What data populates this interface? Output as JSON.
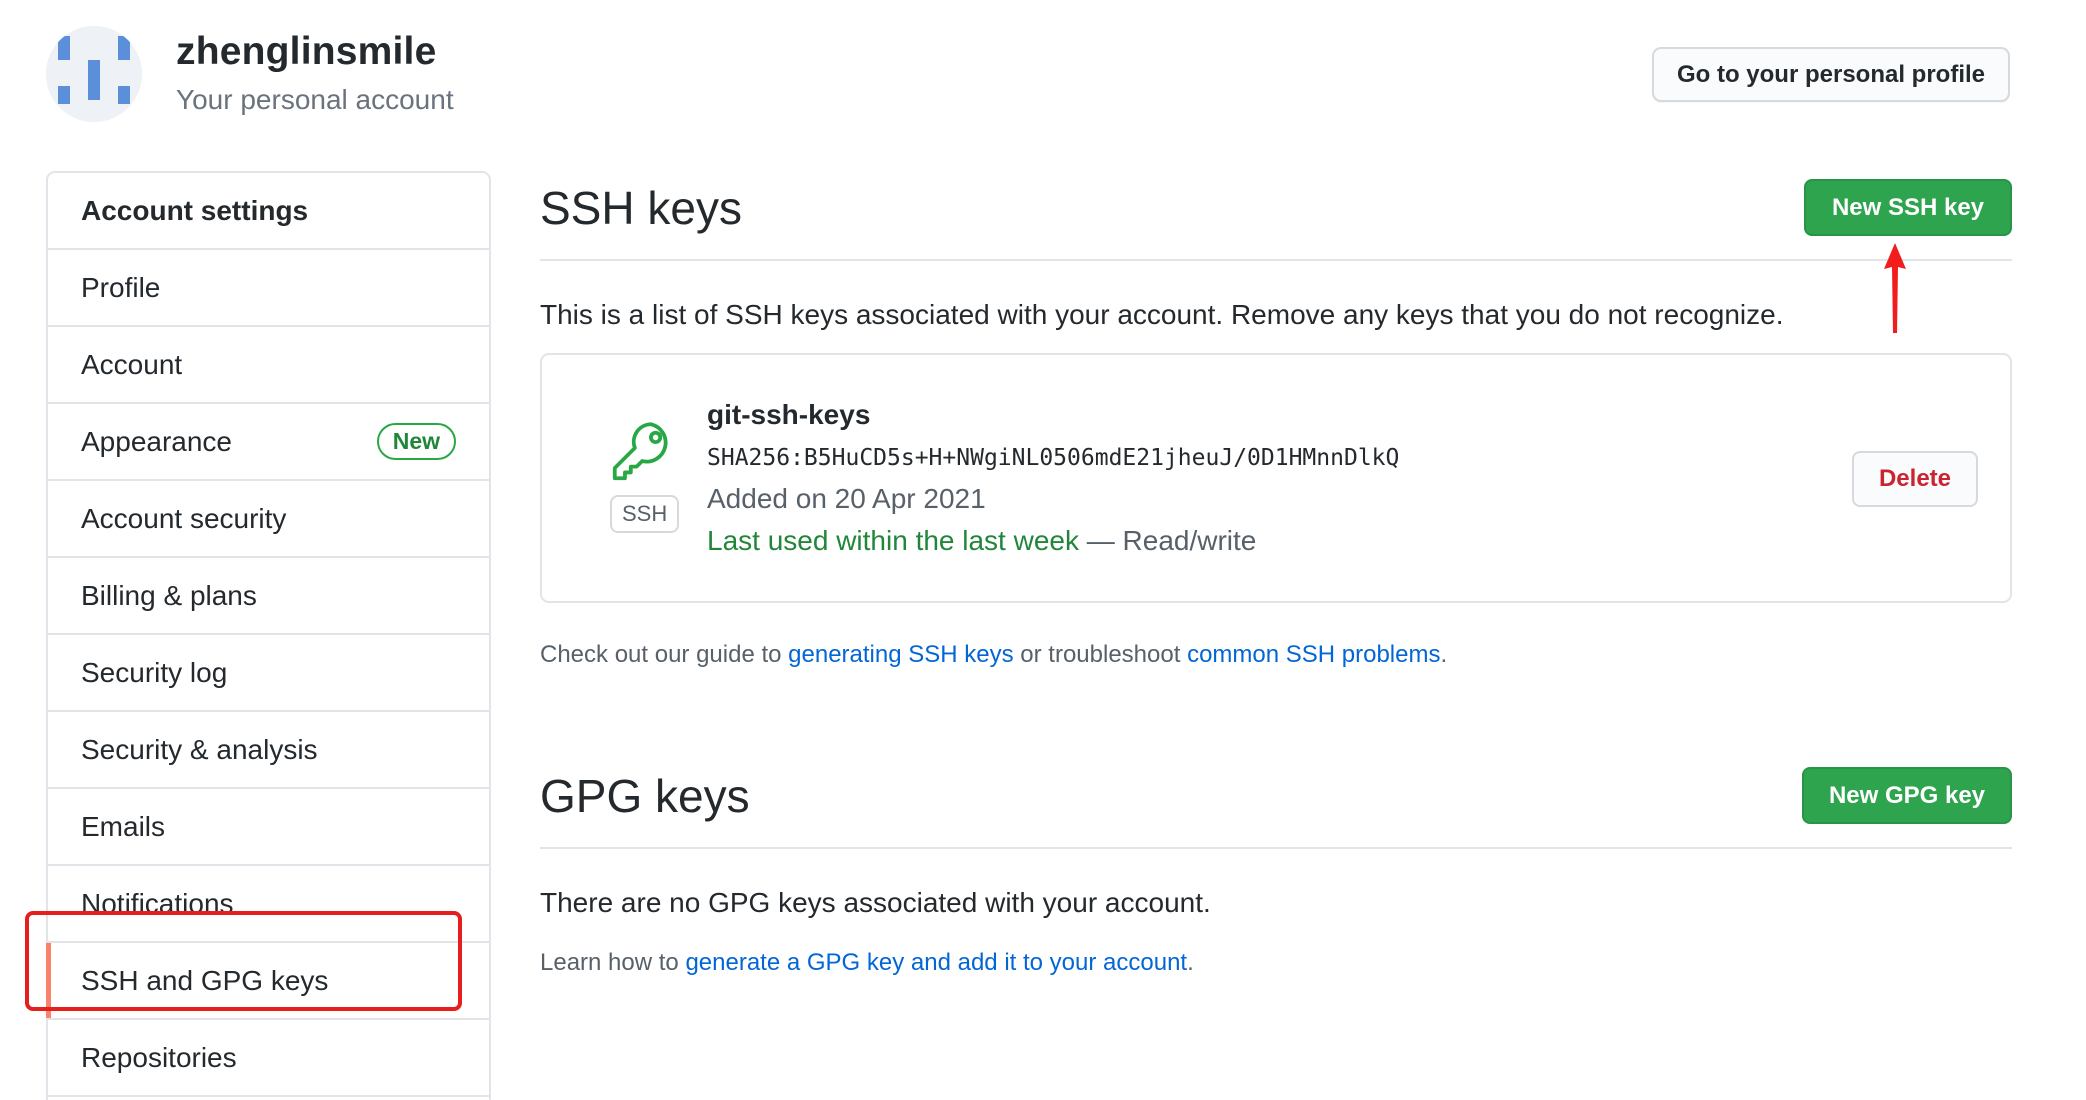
{
  "header": {
    "username": "zhenglinsmile",
    "account_type": "Your personal account",
    "profile_button": "Go to your personal profile"
  },
  "sidebar": {
    "title": "Account settings",
    "items": [
      {
        "label": "Profile"
      },
      {
        "label": "Account"
      },
      {
        "label": "Appearance",
        "badge": "New"
      },
      {
        "label": "Account security"
      },
      {
        "label": "Billing & plans"
      },
      {
        "label": "Security log"
      },
      {
        "label": "Security & analysis"
      },
      {
        "label": "Emails"
      },
      {
        "label": "Notifications"
      },
      {
        "label": "SSH and GPG keys",
        "selected": true
      },
      {
        "label": "Repositories"
      }
    ]
  },
  "ssh": {
    "title": "SSH keys",
    "new_button": "New SSH key",
    "intro": "This is a list of SSH keys associated with your account. Remove any keys that you do not recognize.",
    "key": {
      "type_label": "SSH",
      "name": "git-ssh-keys",
      "fingerprint": "SHA256:B5HuCD5s+H+NWgiNL0506mdE21jheuJ/0D1HMnnDlkQ",
      "added": "Added on 20 Apr 2021",
      "last_used": "Last used within the last week",
      "access": "— Read/write",
      "delete_button": "Delete"
    },
    "guide": {
      "prefix": "Check out our guide to ",
      "link1": "generating SSH keys",
      "middle": " or troubleshoot ",
      "link2": "common SSH problems",
      "suffix": "."
    }
  },
  "gpg": {
    "title": "GPG keys",
    "new_button": "New GPG key",
    "empty": "There are no GPG keys associated with your account.",
    "learn_prefix": "Learn how to ",
    "learn_link": "generate a GPG key and add it to your account",
    "learn_suffix": "."
  },
  "colors": {
    "green_button": "#2ea44f",
    "link": "#0366d6",
    "danger": "#cb2431",
    "selected_marker": "#f9826c",
    "annotation": "#e61e1e"
  }
}
